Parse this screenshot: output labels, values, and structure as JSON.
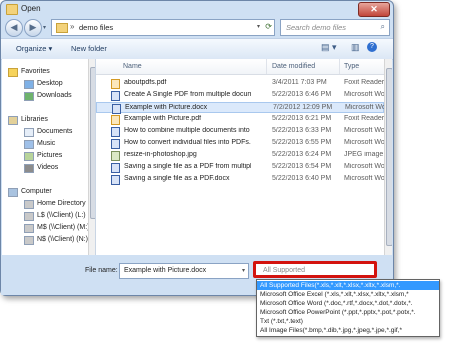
{
  "window": {
    "title": "Open",
    "close_glyph": "✕"
  },
  "nav": {
    "back_glyph": "◀",
    "forward_glyph": "▶",
    "dropdown_glyph": "▾",
    "address_separator": "»",
    "address_path": "demo files",
    "address_dropdown_glyph": "▾",
    "refresh_glyph": "⟳",
    "search_placeholder": "Search demo files",
    "search_glyph": "⌕"
  },
  "toolbar": {
    "organize_label": "Organize ▾",
    "new_folder_label": "New folder",
    "view_glyph": "▤ ▾",
    "pane_glyph": "▥",
    "help_glyph": "?"
  },
  "nav_pane": {
    "items": [
      {
        "label": "Favorites",
        "icon": "star-icon"
      },
      {
        "label": "Desktop",
        "icon": "desktop-icon"
      },
      {
        "label": "Downloads",
        "icon": "downloads-icon"
      },
      {
        "label": "Libraries",
        "icon": "libraries-icon"
      },
      {
        "label": "Documents",
        "icon": "documents-icon"
      },
      {
        "label": "Music",
        "icon": "music-icon"
      },
      {
        "label": "Pictures",
        "icon": "pictures-icon"
      },
      {
        "label": "Videos",
        "icon": "videos-icon"
      },
      {
        "label": "Computer",
        "icon": "computer-icon"
      },
      {
        "label": "Home Directory (",
        "icon": "drive-icon"
      },
      {
        "label": "L$ (\\\\Client) (L:)",
        "icon": "network-drive-icon"
      },
      {
        "label": "M$ (\\\\Client) (M:)",
        "icon": "network-drive-icon"
      },
      {
        "label": "N$ (\\\\Client) (N:)",
        "icon": "network-drive-icon"
      }
    ]
  },
  "file_list": {
    "columns": [
      "Name",
      "Date modified",
      "Type"
    ],
    "rows": [
      {
        "name": "aboutpdfs.pdf",
        "date": "3/4/2011 7:03 PM",
        "type": "Foxit Reader",
        "kind": "pdf"
      },
      {
        "name": "Create A Single PDF from multiple documents.docx",
        "date": "5/22/2013 6:46 PM",
        "type": "Microsoft Word",
        "kind": "doc"
      },
      {
        "name": "Example with Picture.docx",
        "date": "7/2/2012 12:09 PM",
        "type": "Microsoft Word",
        "kind": "doc"
      },
      {
        "name": "Example with Picture.pdf",
        "date": "5/22/2013 6:21 PM",
        "type": "Foxit Reader",
        "kind": "pdf"
      },
      {
        "name": "How to combine multiple documents into one PDF.docx",
        "date": "5/22/2013 6:33 PM",
        "type": "Microsoft Word",
        "kind": "doc"
      },
      {
        "name": "How to convert individual files into PDFs.docx",
        "date": "5/22/2013 6:55 PM",
        "type": "Microsoft Word",
        "kind": "doc"
      },
      {
        "name": "resize-in-photoshop.jpg",
        "date": "5/22/2013 6:24 PM",
        "type": "JPEG image",
        "kind": "img"
      },
      {
        "name": "Saving a single file as a PDF from multiple documents.docx",
        "date": "5/22/2013 6:54 PM",
        "type": "Microsoft Word",
        "kind": "doc"
      },
      {
        "name": "Saving a single file as a PDF.docx",
        "date": "5/22/2013 6:40 PM",
        "type": "Microsoft Word",
        "kind": "doc"
      }
    ],
    "selected_index": 2
  },
  "bottom": {
    "file_name_label": "File name:",
    "file_name_value": "Example with Picture.docx",
    "file_name_dropdown_glyph": "▾",
    "filter_value": "All Supported",
    "filter_options": [
      "All Supported Files(*.xls,*.xlt,*.xlsx,*.xltx,*.xlsm,*.",
      "Microsoft Office Excel (*.xls,*.xlt,*.xlsx,*.xltx,*.xlsm,*",
      "Microsoft Office Word (*.doc,*.rtf,*.docx,*.dot,*.dotx,*.",
      "Microsoft Office PowerPoint (*.ppt,*.pptx,*.pot,*.potx,*.",
      "Txt (*.txt,*.text)",
      "All Image Files(*.bmp,*.dib,*.jpg,*.jpeg,*.jpe,*.gif,*"
    ],
    "filter_selected_index": 0
  },
  "colors": {
    "highlight_border": "#d3130e",
    "selection": "#3399ff",
    "row_selection": "#dbe9fb"
  }
}
